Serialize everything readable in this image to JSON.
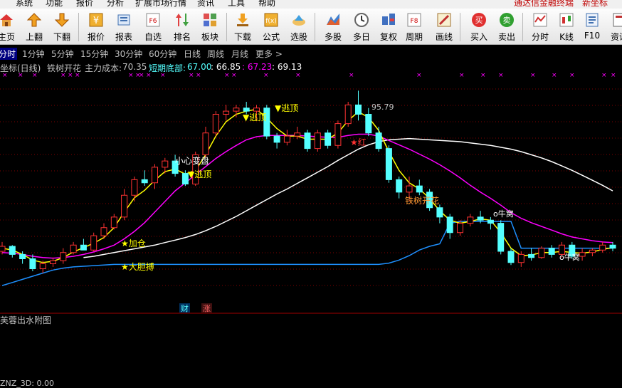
{
  "menubar": {
    "items": [
      "系统",
      "功能",
      "报价",
      "分析",
      "扩展市场行情",
      "资讯",
      "工具",
      "帮助"
    ],
    "brand": "通达信金融终端",
    "indicator_name": "新坐标"
  },
  "toolbar": {
    "buttons": [
      {
        "label": "主页",
        "icon": "home-icon"
      },
      {
        "label": "上翻",
        "icon": "page-up-icon"
      },
      {
        "label": "下翻",
        "icon": "page-down-icon"
      },
      {
        "label": "报价",
        "icon": "quote-icon"
      },
      {
        "label": "报表",
        "icon": "report-icon"
      },
      {
        "label": "自选",
        "icon": "watchlist-f6-icon"
      },
      {
        "label": "排名",
        "icon": "ranking-icon"
      },
      {
        "label": "板块",
        "icon": "sector-icon"
      },
      {
        "label": "下载",
        "icon": "download-icon"
      },
      {
        "label": "公式",
        "icon": "formula-icon"
      },
      {
        "label": "选股",
        "icon": "stock-pick-icon"
      },
      {
        "label": "多股",
        "icon": "multi-stock-icon"
      },
      {
        "label": "多日",
        "icon": "multi-day-icon"
      },
      {
        "label": "复权",
        "icon": "adjust-icon"
      },
      {
        "label": "周期",
        "icon": "period-f8-icon"
      },
      {
        "label": "画线",
        "icon": "draw-line-icon"
      },
      {
        "label": "买入",
        "icon": "buy-icon"
      },
      {
        "label": "卖出",
        "icon": "sell-icon"
      },
      {
        "label": "分时",
        "icon": "intraday-icon"
      },
      {
        "label": "K线",
        "icon": "kline-icon"
      },
      {
        "label": "F10",
        "icon": "f10-icon"
      },
      {
        "label": "资讯",
        "icon": "news-icon"
      }
    ]
  },
  "periods": {
    "items": [
      "分时",
      "1分钟",
      "5分钟",
      "15分钟",
      "30分钟",
      "60分钟",
      "日线",
      "周线",
      "月线",
      "更多 >"
    ],
    "active": "分时"
  },
  "indicator_line": {
    "name": "新坐标(日线)",
    "tag": "铁树开花",
    "cost_label": "主力成本:",
    "cost_value": "70.35",
    "bottom_label": "短期底部:",
    "bottom_value": "67.00",
    "v2": ": 66.85",
    "v3": ": 67.23",
    "v4": ": 69.13"
  },
  "annotations": {
    "escape1": "▼逃顶",
    "escape2": "▼逃顶",
    "escape3": "▼逃顶",
    "caution": "小心变盘",
    "peak": "95.79",
    "red_star": "★红",
    "tree": "铁树开花",
    "add": "★加仓",
    "bold": "★大胆搏",
    "nest1": "o牛窝",
    "nest2": "o牛窝",
    "cai": "财",
    "zhang": "涨"
  },
  "subchart": {
    "title": "芙蓉出水附图"
  },
  "bottom": {
    "text": "ZNZ_3D: 0.00"
  },
  "colors": {
    "up": "#ff3232",
    "down": "#54ffff",
    "ma_fast": "#ffff00",
    "ma_mid": "#ff00ff",
    "ma_slow": "#ffffff",
    "cost_line": "#1e90ff",
    "grid": "#800000"
  },
  "chart_data": {
    "type": "candlestick",
    "peak_label": "95.79",
    "candles": [
      [
        70,
        71.5,
        69.5,
        70.8
      ],
      [
        70.8,
        71,
        69,
        69.5
      ],
      [
        69.5,
        70,
        68,
        68.8
      ],
      [
        68.8,
        69.5,
        66.8,
        67.2
      ],
      [
        67.2,
        68.5,
        66.5,
        68
      ],
      [
        68,
        69,
        67.5,
        68.5
      ],
      [
        68.5,
        70.5,
        68,
        69.8
      ],
      [
        69.8,
        71.5,
        69.5,
        71
      ],
      [
        71,
        72,
        70.5,
        70.2
      ],
      [
        70.2,
        73,
        70,
        72.5
      ],
      [
        72.5,
        74.5,
        72,
        73.8
      ],
      [
        73.8,
        76,
        73.5,
        75.5
      ],
      [
        75.5,
        80,
        75,
        79
      ],
      [
        79,
        82,
        78,
        81.5
      ],
      [
        81.5,
        83,
        80.5,
        81
      ],
      [
        81,
        84,
        80,
        83.5
      ],
      [
        83.5,
        85,
        82.5,
        84.5
      ],
      [
        84.5,
        85.5,
        82,
        82.5
      ],
      [
        82.5,
        83,
        80.5,
        80.8
      ],
      [
        80.8,
        86,
        80.5,
        85.5
      ],
      [
        85.5,
        90,
        85,
        89
      ],
      [
        89,
        92.5,
        88.5,
        92
      ],
      [
        92,
        93.5,
        91,
        92.5
      ],
      [
        92.5,
        93.5,
        91.5,
        93
      ],
      [
        93,
        94,
        92,
        92.5
      ],
      [
        92.5,
        93.5,
        91,
        93
      ],
      [
        93,
        93.5,
        88,
        88.5
      ],
      [
        88.5,
        89,
        86.5,
        87.5
      ],
      [
        87.5,
        89.5,
        87,
        88.5
      ],
      [
        88.5,
        90,
        88,
        89
      ],
      [
        89,
        89.5,
        86,
        86.5
      ],
      [
        86.5,
        89.5,
        86,
        89
      ],
      [
        89,
        89.5,
        86.5,
        87
      ],
      [
        87,
        91,
        86.5,
        90.5
      ],
      [
        90.5,
        94,
        90,
        93.5
      ],
      [
        93.5,
        95.79,
        91,
        92
      ],
      [
        92,
        93,
        88.5,
        89
      ],
      [
        89,
        90,
        86,
        86.5
      ],
      [
        86.5,
        87,
        81,
        81.5
      ],
      [
        81.5,
        82,
        78.5,
        79.5
      ],
      [
        79.5,
        82,
        78,
        80.5
      ],
      [
        80.5,
        81.5,
        79,
        79.5
      ],
      [
        79.5,
        80,
        76.5,
        77
      ],
      [
        77,
        77.5,
        74.5,
        75.5
      ],
      [
        75.5,
        76,
        72,
        73
      ],
      [
        73,
        75,
        72.5,
        74.5
      ],
      [
        74.5,
        76,
        74,
        75.5
      ],
      [
        75.5,
        76.5,
        74.5,
        75
      ],
      [
        75,
        75.5,
        73.5,
        74.5
      ],
      [
        74.5,
        75,
        69.5,
        70
      ],
      [
        70,
        70.5,
        67.8,
        68.2
      ],
      [
        68.2,
        70,
        67.5,
        69.5
      ],
      [
        69.5,
        70.5,
        68.5,
        69
      ],
      [
        69,
        70.8,
        68.8,
        70.5
      ],
      [
        70.5,
        71,
        69,
        69.5
      ],
      [
        69.5,
        71.5,
        69,
        71
      ],
      [
        71,
        71.5,
        68.8,
        69.2
      ],
      [
        69.2,
        70.5,
        68.5,
        69.8
      ],
      [
        69.8,
        70.5,
        69.2,
        70.2
      ],
      [
        70.2,
        71.5,
        69.8,
        71
      ],
      [
        71,
        71.5,
        70,
        70.5
      ]
    ],
    "ma_fast": [
      70.5,
      70.2,
      69.5,
      68.6,
      68.2,
      68.4,
      69,
      69.9,
      70.6,
      71.3,
      72.2,
      73.8,
      76.3,
      78.6,
      79.8,
      81.4,
      82.8,
      83.2,
      82.4,
      83,
      85.5,
      88.5,
      90.8,
      92,
      92.5,
      92.8,
      91.4,
      89.7,
      88.5,
      88.5,
      88,
      88,
      88,
      89,
      91,
      92.4,
      91.5,
      89.4,
      86,
      83,
      81,
      80,
      78.5,
      76.5,
      75,
      74.5,
      74.8,
      75.2,
      75,
      73,
      70.5,
      69.3,
      69.4,
      69.8,
      69.8,
      70,
      69.8,
      69.7,
      69.9,
      70.3,
      70.6
    ],
    "ma_mid": [
      69.8,
      69.7,
      69.5,
      69.2,
      69,
      68.9,
      69,
      69.2,
      69.5,
      69.9,
      70.4,
      71,
      72,
      73.2,
      74.6,
      76.3,
      78,
      79.7,
      81,
      82.3,
      83.6,
      84.9,
      86,
      87,
      87.9,
      88.4,
      88.6,
      88.6,
      88.6,
      88.6,
      88.5,
      88.4,
      88.3,
      88.3,
      88.6,
      88.8,
      88.8,
      88.5,
      87.8,
      87.1,
      86.4,
      85.6,
      84.8,
      83.9,
      82.9,
      81.8,
      80.6,
      79.5,
      78.5,
      77.4,
      76.2,
      75.3,
      74.6,
      74,
      73.4,
      72.8,
      72.3,
      72,
      71.7,
      71.5,
      71.4
    ],
    "ma_slow": [
      null,
      null,
      null,
      null,
      null,
      null,
      null,
      null,
      69,
      69.2,
      69.5,
      69.8,
      70.1,
      70.4,
      70.7,
      71,
      71.4,
      71.8,
      72.2,
      72.7,
      73.3,
      74,
      74.8,
      75.6,
      76.5,
      77.4,
      78.3,
      79.2,
      80,
      80.9,
      81.8,
      82.7,
      83.6,
      84.6,
      85.5,
      86.4,
      87.1,
      87.6,
      87.9,
      88,
      88.1,
      88,
      87.9,
      87.8,
      87.7,
      87.6,
      87.4,
      87.2,
      87,
      86.7,
      86.4,
      86,
      85.5,
      85,
      84.4,
      83.7,
      83,
      82.2,
      81.4,
      80.6,
      79.7
    ],
    "cost_line": [
      64.5,
      65,
      65.5,
      66,
      66.5,
      67,
      67.3,
      67.5,
      67.6,
      67.7,
      67.8,
      67.9,
      67.9,
      67.9,
      67.9,
      67.9,
      67.9,
      67.9,
      67.9,
      67.9,
      67.9,
      67.9,
      67.9,
      67.9,
      67.9,
      67.9,
      67.9,
      67.9,
      67.9,
      67.9,
      67.9,
      67.9,
      67.9,
      67.9,
      67.9,
      67.9,
      67.9,
      67.9,
      68.1,
      68.6,
      69.3,
      70.2,
      70.8,
      71.2,
      74.5,
      74.8,
      74.8,
      74.8,
      74.8,
      74.8,
      74.8,
      70.5,
      70.5,
      70.5,
      70.5,
      70.5,
      70.5,
      70.5,
      70.5,
      70.5,
      70.5
    ],
    "ylim": [
      62,
      98
    ]
  }
}
